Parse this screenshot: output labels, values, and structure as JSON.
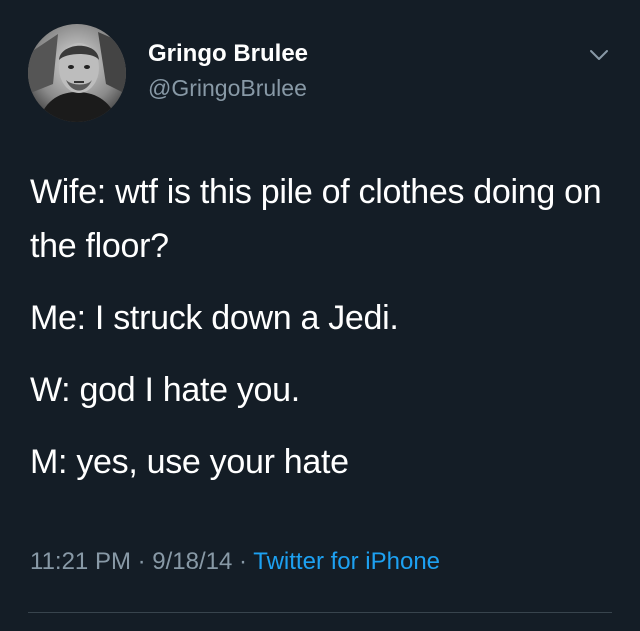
{
  "user": {
    "display_name": "Gringo Brulee",
    "handle": "@GringoBrulee"
  },
  "tweet": {
    "lines": [
      "Wife: wtf is this pile of clothes doing on the floor?",
      "Me: I struck down a Jedi.",
      "W: god I hate you.",
      "M: yes, use your hate"
    ],
    "time": "11:21 PM",
    "separator": " · ",
    "date": "9/18/14",
    "source": "Twitter for iPhone"
  },
  "icons": {
    "menu": "chevron-down-icon",
    "avatar": "profile-photo"
  },
  "colors": {
    "background": "#141d26",
    "text": "#ffffff",
    "secondary": "#8899a6",
    "link": "#1da1f2"
  }
}
